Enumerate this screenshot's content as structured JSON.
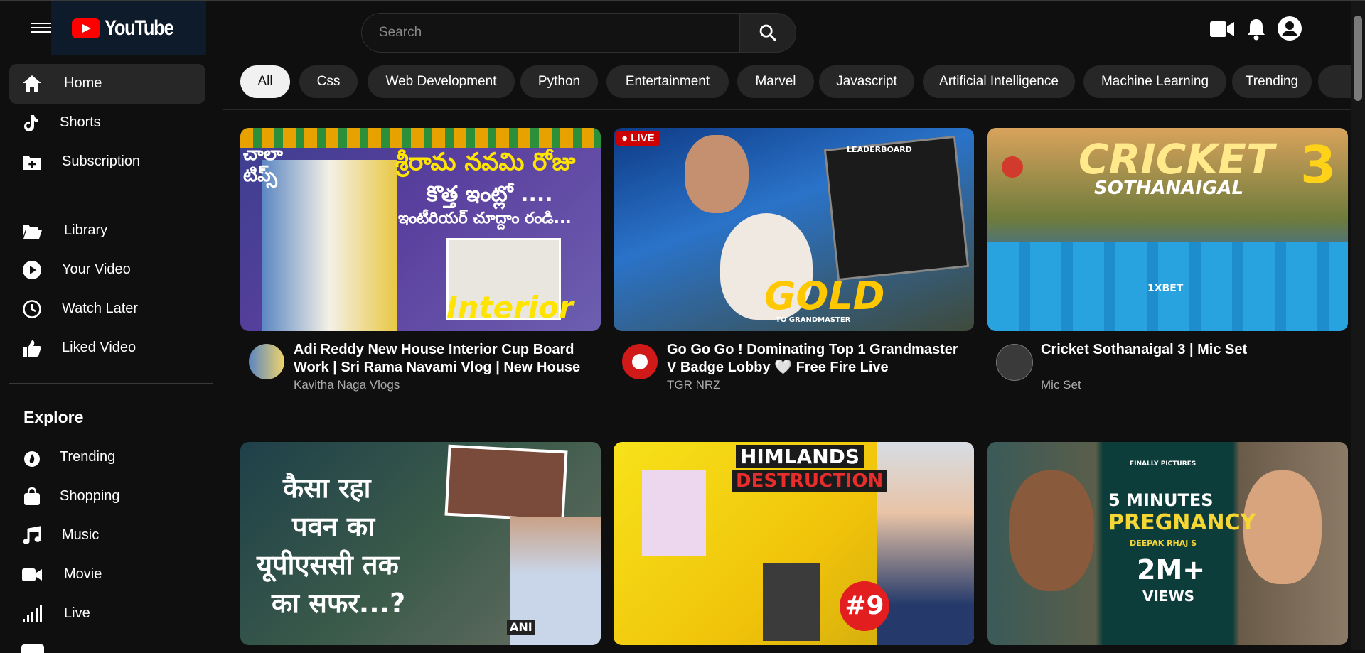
{
  "header": {
    "logo_text": "YouTube",
    "search_placeholder": "Search"
  },
  "sidebar": {
    "main": [
      {
        "label": "Home",
        "icon": "home-icon",
        "active": true
      },
      {
        "label": "Shorts",
        "icon": "shorts-icon"
      },
      {
        "label": "Subscription",
        "icon": "subscription-icon"
      }
    ],
    "library": [
      {
        "label": "Library",
        "icon": "folder-icon"
      },
      {
        "label": "Your Video",
        "icon": "play-circle-icon"
      },
      {
        "label": "Watch Later",
        "icon": "clock-icon"
      },
      {
        "label": "Liked Video",
        "icon": "thumbs-up-icon"
      }
    ],
    "explore_title": "Explore",
    "explore": [
      {
        "label": "Trending",
        "icon": "fire-icon"
      },
      {
        "label": "Shopping",
        "icon": "shopping-bag-icon"
      },
      {
        "label": "Music",
        "icon": "music-icon"
      },
      {
        "label": "Movie",
        "icon": "movie-camera-icon"
      },
      {
        "label": "Live",
        "icon": "signal-icon"
      }
    ]
  },
  "chips": [
    "All",
    "Css",
    "Web Development",
    "Python",
    "Entertainment",
    "Marvel",
    "Javascript",
    "Artificial Intelligence",
    "Machine Learning",
    "Trending"
  ],
  "videos": [
    {
      "title": "Adi Reddy New House Interior Cup Board Work | Sri Rama Navami Vlog | New House",
      "channel": "Kavitha Naga Vlogs",
      "thumb_text": [
        "చాలా టిప్స్",
        "శ్రీరామ నవమి రోజు",
        "కొత్త ఇంట్లో ....",
        "ఇంటీరియర్ చూద్దాం రండి...",
        "Interior"
      ]
    },
    {
      "title": "Go Go Go ! Dominating Top 1 Grandmaster V Badge Lobby 🤍 Free Fire Live",
      "channel": "TGR NRZ",
      "thumb_text": [
        "LIVE",
        "GOLD",
        "TO GRANDMASTER",
        "LEADERBOARD"
      ]
    },
    {
      "title": "Cricket Sothanaigal 3 | Mic Set",
      "channel": "Mic Set",
      "thumb_text": [
        "CRICKET",
        "SOTHANAIGAL",
        "3",
        "1XBET"
      ]
    },
    {
      "thumb_text": [
        "कैसा रहा",
        "पवन का",
        "यूपीएससी तक",
        "का सफर...?",
        "ANI"
      ]
    },
    {
      "thumb_text": [
        "HIMLANDS",
        "DESTRUCTION",
        "#9"
      ]
    },
    {
      "thumb_text": [
        "FINALLY PICTURES",
        "5 MINUTES",
        "PREGNANCY",
        "DEEPAK RHAJ S",
        "2M+",
        "VIEWS"
      ]
    }
  ],
  "colors": {
    "background": "#0f0f0f",
    "chip": "#272727",
    "active_chip": "#f1f1f1",
    "brand_red": "#ff0000"
  }
}
